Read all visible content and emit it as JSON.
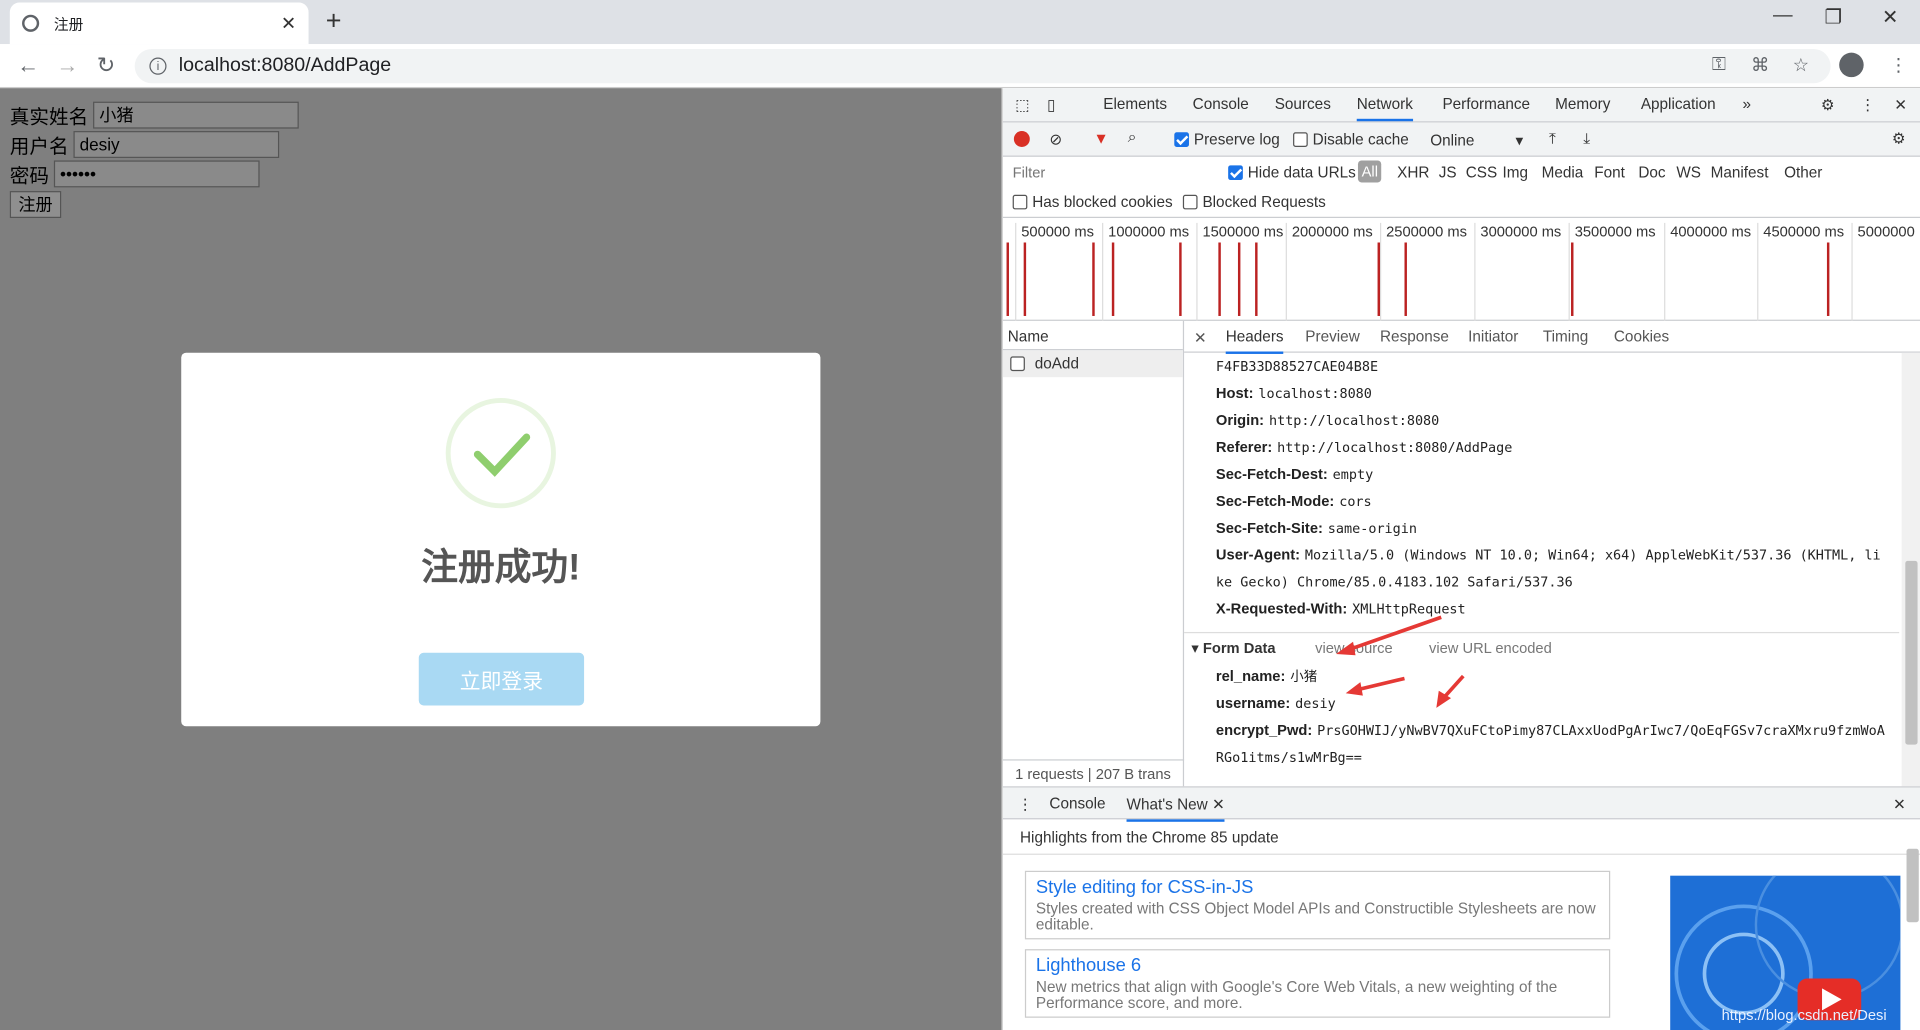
{
  "browser": {
    "tab_title": "注册",
    "url": "localhost:8080/AddPage"
  },
  "form": {
    "realname_label": "真实姓名",
    "realname_value": "小猪",
    "username_label": "用户名",
    "username_value": "desiy",
    "password_label": "密码",
    "password_value": "••••••",
    "submit_label": "注册"
  },
  "modal": {
    "title": "注册成功!",
    "button": "立即登录"
  },
  "devtools": {
    "tabs": [
      "Elements",
      "Console",
      "Sources",
      "Network",
      "Performance",
      "Memory",
      "Application"
    ],
    "preserve_log": "Preserve log",
    "disable_cache": "Disable cache",
    "throttle": "Online",
    "filter_placeholder": "Filter",
    "hide_data_urls": "Hide data URLs",
    "types": [
      "All",
      "XHR",
      "JS",
      "CSS",
      "Img",
      "Media",
      "Font",
      "Doc",
      "WS",
      "Manifest",
      "Other"
    ],
    "has_blocked": "Has blocked cookies",
    "blocked_requests": "Blocked Requests",
    "ticks": [
      "500000 ms",
      "1000000 ms",
      "1500000 ms",
      "2000000 ms",
      "2500000 ms",
      "3000000 ms",
      "3500000 ms",
      "4000000 ms",
      "4500000 ms",
      "5000000"
    ],
    "name_header": "Name",
    "request_name": "doAdd",
    "footer": "1 requests | 207 B trans",
    "detail_tabs": [
      "Headers",
      "Preview",
      "Response",
      "Initiator",
      "Timing",
      "Cookies"
    ],
    "headers": [
      {
        "k": "",
        "v": "F4FB33D88527CAE04B8E"
      },
      {
        "k": "Host:",
        "v": "localhost:8080"
      },
      {
        "k": "Origin:",
        "v": "http://localhost:8080"
      },
      {
        "k": "Referer:",
        "v": "http://localhost:8080/AddPage"
      },
      {
        "k": "Sec-Fetch-Dest:",
        "v": "empty"
      },
      {
        "k": "Sec-Fetch-Mode:",
        "v": "cors"
      },
      {
        "k": "Sec-Fetch-Site:",
        "v": "same-origin"
      },
      {
        "k": "User-Agent:",
        "v": "Mozilla/5.0 (Windows NT 10.0; Win64; x64) AppleWebKit/537.36 (KHTML, li"
      },
      {
        "k": "",
        "v": "ke Gecko) Chrome/85.0.4183.102 Safari/537.36"
      },
      {
        "k": "X-Requested-With:",
        "v": "XMLHttpRequest"
      }
    ],
    "form_data_title": "Form Data",
    "view_source": "view source",
    "view_url": "view URL encoded",
    "form_fields": [
      {
        "k": "rel_name:",
        "v": "小猪"
      },
      {
        "k": "username:",
        "v": "desiy"
      },
      {
        "k": "encrypt_Pwd:",
        "v": "PrsGOHWIJ/yNwBV7QXuFCtoPimy87CLAxxUodPgArIwc7/QoEqFGSv7craXMxru9fzmWoA"
      },
      {
        "k": "",
        "v": "RGo1itms/s1wMrBg=="
      }
    ],
    "drawer_tabs": [
      "Console",
      "What's New"
    ],
    "highlights": "Highlights from the Chrome 85 update",
    "cards": [
      {
        "title": "Style editing for CSS-in-JS",
        "desc": "Styles created with CSS Object Model APIs and Constructible Stylesheets are now editable."
      },
      {
        "title": "Lighthouse 6",
        "desc": "New metrics that align with Google's Core Web Vitals, a new weighting of the Performance score, and more."
      }
    ],
    "watermark": "https://blog.csdn.net/Desi"
  }
}
